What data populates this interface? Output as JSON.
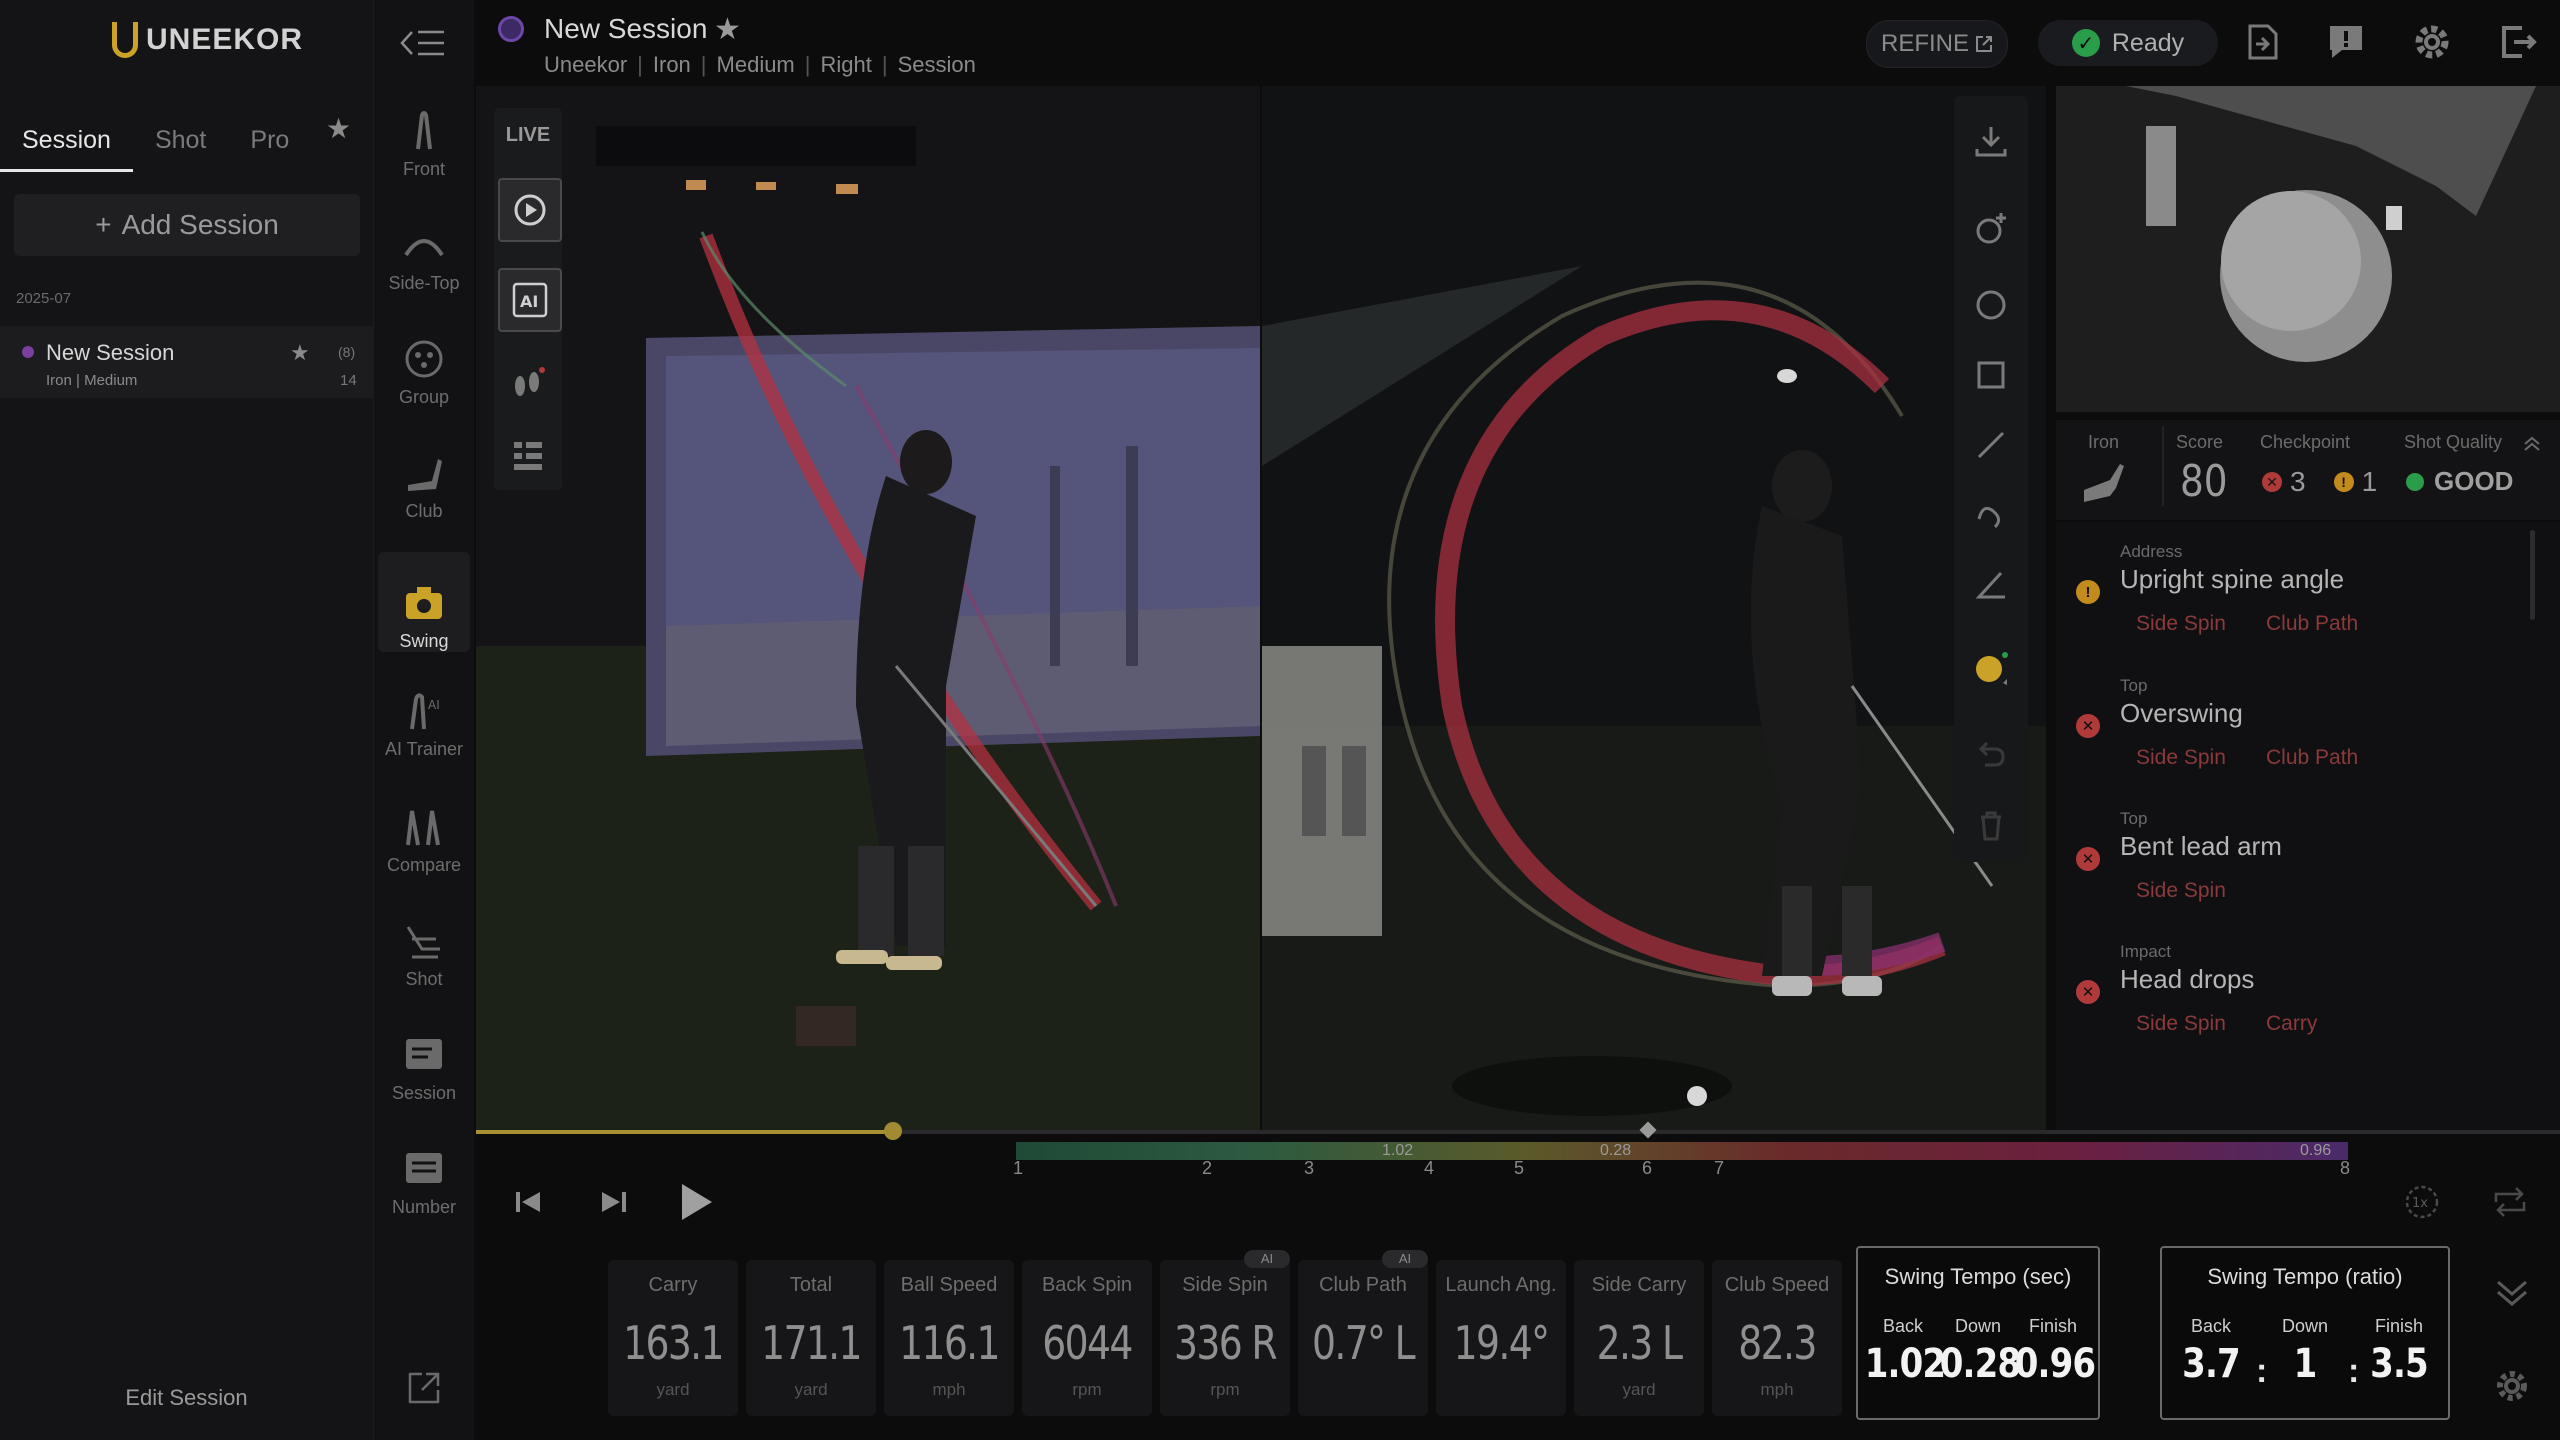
{
  "app": {
    "brand": "UNEEKOR"
  },
  "left_panel": {
    "tabs": [
      "Session",
      "Shot",
      "Pro"
    ],
    "add_session": "Add Session",
    "date_group": "2025-07",
    "session": {
      "name": "New Session",
      "sub": "Iron | Medium",
      "count_top": "(8)",
      "count_bottom": "14"
    },
    "edit_session": "Edit Session"
  },
  "rail": {
    "items": [
      "Front",
      "Side-Top",
      "Group",
      "Club",
      "Swing",
      "AI Trainer",
      "Compare",
      "Shot",
      "Session",
      "Number"
    ],
    "active": "Swing"
  },
  "header": {
    "title": "New Session",
    "breadcrumb": [
      "Uneekor",
      "Iron",
      "Medium",
      "Right",
      "Session"
    ],
    "refine": "REFINE",
    "status": "Ready"
  },
  "video": {
    "live_label": "LIVE",
    "ai_label": "AI"
  },
  "analysis": {
    "club": "Iron",
    "score_label": "Score",
    "score": "80",
    "checkpoint_label": "Checkpoint",
    "checkpoint_errors": "3",
    "checkpoint_warnings": "1",
    "quality_label": "Shot Quality",
    "quality": "GOOD",
    "checkpoints": [
      {
        "phase": "Address",
        "title": "Upright spine angle",
        "level": "warn",
        "tags": [
          "Side Spin",
          "Club Path"
        ]
      },
      {
        "phase": "Top",
        "title": "Overswing",
        "level": "err",
        "tags": [
          "Side Spin",
          "Club Path"
        ]
      },
      {
        "phase": "Top",
        "title": "Bent lead arm",
        "level": "err",
        "tags": [
          "Side Spin"
        ]
      },
      {
        "phase": "Impact",
        "title": "Head drops",
        "level": "err",
        "tags": [
          "Side Spin",
          "Carry"
        ]
      }
    ]
  },
  "timeline": {
    "progress": 0.2,
    "phases": [
      "1",
      "2",
      "3",
      "4",
      "5",
      "6",
      "7",
      "8"
    ],
    "values": [
      "1.02",
      "0.28",
      "0.96"
    ]
  },
  "stats": [
    {
      "name": "Carry",
      "value": "163.1",
      "unit": "yard"
    },
    {
      "name": "Total",
      "value": "171.1",
      "unit": "yard"
    },
    {
      "name": "Ball Speed",
      "value": "116.1",
      "unit": "mph"
    },
    {
      "name": "Back Spin",
      "value": "6044",
      "unit": "rpm"
    },
    {
      "name": "Side Spin",
      "value": "336 R",
      "unit": "rpm",
      "ai": "AI"
    },
    {
      "name": "Club Path",
      "value": "0.7° L",
      "unit": "",
      "ai": "AI"
    },
    {
      "name": "Launch Ang.",
      "value": "19.4°",
      "unit": ""
    },
    {
      "name": "Side Carry",
      "value": "2.3 L",
      "unit": "yard"
    },
    {
      "name": "Club Speed",
      "value": "82.3",
      "unit": "mph"
    }
  ],
  "tempo_sec": {
    "title": "Swing Tempo (sec)",
    "labels": [
      "Back",
      "Down",
      "Finish"
    ],
    "values": [
      "1.02",
      "0.28",
      "0.96"
    ]
  },
  "tempo_ratio": {
    "title": "Swing Tempo (ratio)",
    "labels": [
      "Back",
      "Down",
      "Finish"
    ],
    "values": [
      "3.7",
      "1",
      "3.5"
    ]
  },
  "colors": {
    "accent": "#c9a227",
    "good": "#2a9d4a",
    "error": "#b03a3a",
    "warning": "#c38a1e"
  }
}
